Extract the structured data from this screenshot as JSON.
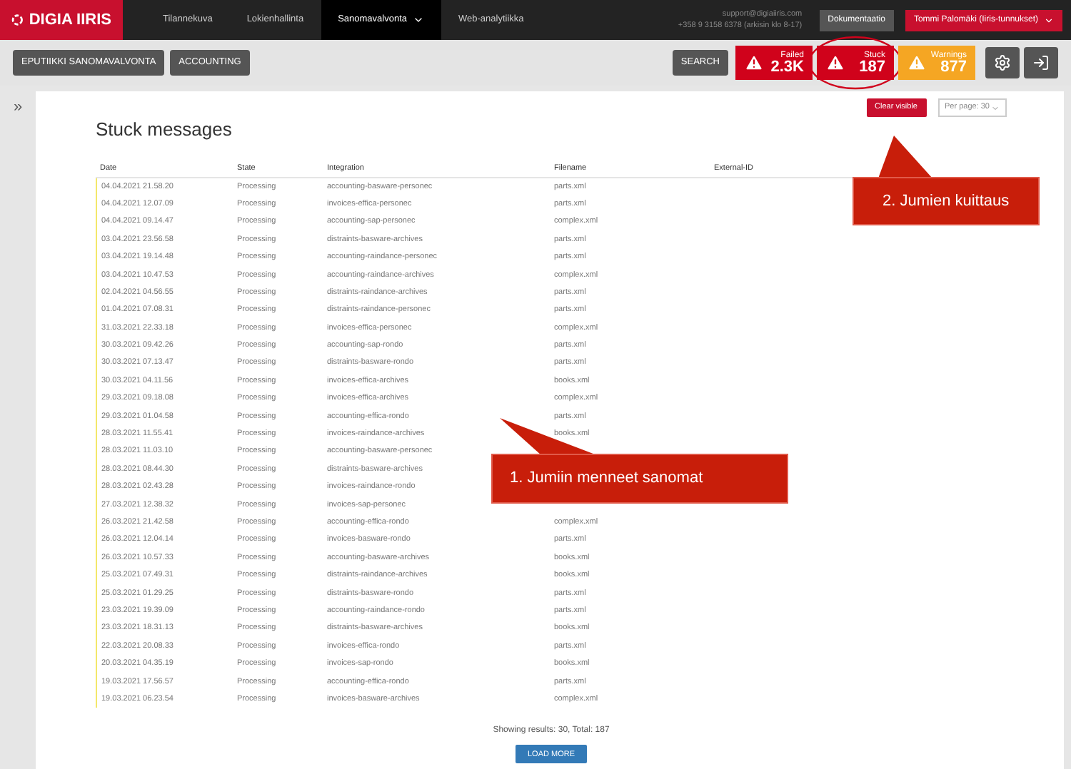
{
  "brand": {
    "name": "DIGIA IIRIS"
  },
  "nav": [
    {
      "label": "Tilannekuva",
      "selected": false
    },
    {
      "label": "Lokienhallinta",
      "selected": false
    },
    {
      "label": "Sanomavalvonta",
      "selected": true,
      "dropdown": true
    },
    {
      "label": "Web-analytiikka",
      "selected": false
    }
  ],
  "support": {
    "email": "support@digiaiiris.com",
    "phone": "+358 9 3158 6378 (arkisin klo 8-17)"
  },
  "docs_button": "Dokumentaatio",
  "user_menu": "Tommi Palomäki (Iiris-tunnukset)",
  "toolbar": {
    "filters": [
      "EPUTIIKKI SANOMAVALVONTA",
      "ACCOUNTING"
    ],
    "search": "SEARCH",
    "counters": [
      {
        "label": "Failed",
        "value": "2.3K",
        "color": "#d0021b",
        "circled": false
      },
      {
        "label": "Stuck",
        "value": "187",
        "color": "#d0021b",
        "circled": true
      },
      {
        "label": "Warnings",
        "value": "877",
        "color": "#f5a623",
        "circled": false
      }
    ]
  },
  "sidebar_toggle": "»",
  "page": {
    "title": "Stuck messages",
    "clear_button": "Clear visible",
    "per_page": "Per page: 30"
  },
  "table": {
    "columns": [
      "Date",
      "State",
      "Integration",
      "Filename",
      "External-ID"
    ],
    "rows": [
      {
        "date": "04.04.2021 21.58.20",
        "state": "Processing",
        "integration": "accounting-basware-personec",
        "filename": "parts.xml"
      },
      {
        "date": "04.04.2021 12.07.09",
        "state": "Processing",
        "integration": "invoices-effica-personec",
        "filename": "parts.xml"
      },
      {
        "date": "04.04.2021 09.14.47",
        "state": "Processing",
        "integration": "accounting-sap-personec",
        "filename": "complex.xml"
      },
      {
        "date": "03.04.2021 23.56.58",
        "state": "Processing",
        "integration": "distraints-basware-archives",
        "filename": "parts.xml"
      },
      {
        "date": "03.04.2021 19.14.48",
        "state": "Processing",
        "integration": "accounting-raindance-personec",
        "filename": "parts.xml"
      },
      {
        "date": "03.04.2021 10.47.53",
        "state": "Processing",
        "integration": "accounting-raindance-archives",
        "filename": "complex.xml"
      },
      {
        "date": "02.04.2021 04.56.55",
        "state": "Processing",
        "integration": "distraints-raindance-archives",
        "filename": "parts.xml"
      },
      {
        "date": "01.04.2021 07.08.31",
        "state": "Processing",
        "integration": "distraints-raindance-personec",
        "filename": "parts.xml"
      },
      {
        "date": "31.03.2021 22.33.18",
        "state": "Processing",
        "integration": "invoices-effica-personec",
        "filename": "complex.xml"
      },
      {
        "date": "30.03.2021 09.42.26",
        "state": "Processing",
        "integration": "accounting-sap-rondo",
        "filename": "parts.xml"
      },
      {
        "date": "30.03.2021 07.13.47",
        "state": "Processing",
        "integration": "distraints-basware-rondo",
        "filename": "parts.xml"
      },
      {
        "date": "30.03.2021 04.11.56",
        "state": "Processing",
        "integration": "invoices-effica-archives",
        "filename": "books.xml"
      },
      {
        "date": "29.03.2021 09.18.08",
        "state": "Processing",
        "integration": "invoices-effica-archives",
        "filename": "complex.xml"
      },
      {
        "date": "29.03.2021 01.04.58",
        "state": "Processing",
        "integration": "accounting-effica-rondo",
        "filename": "parts.xml"
      },
      {
        "date": "28.03.2021 11.55.41",
        "state": "Processing",
        "integration": "invoices-raindance-archives",
        "filename": "books.xml"
      },
      {
        "date": "28.03.2021 11.03.10",
        "state": "Processing",
        "integration": "accounting-basware-personec"
      },
      {
        "date": "28.03.2021 08.44.30",
        "state": "Processing",
        "integration": "distraints-basware-archives"
      },
      {
        "date": "28.03.2021 02.43.28",
        "state": "Processing",
        "integration": "invoices-raindance-rondo"
      },
      {
        "date": "27.03.2021 12.38.32",
        "state": "Processing",
        "integration": "invoices-sap-personec"
      },
      {
        "date": "26.03.2021 21.42.58",
        "state": "Processing",
        "integration": "accounting-effica-rondo",
        "filename": "complex.xml"
      },
      {
        "date": "26.03.2021 12.04.14",
        "state": "Processing",
        "integration": "invoices-basware-rondo",
        "filename": "parts.xml"
      },
      {
        "date": "26.03.2021 10.57.33",
        "state": "Processing",
        "integration": "accounting-basware-archives",
        "filename": "books.xml"
      },
      {
        "date": "25.03.2021 07.49.31",
        "state": "Processing",
        "integration": "distraints-raindance-archives",
        "filename": "books.xml"
      },
      {
        "date": "25.03.2021 01.29.25",
        "state": "Processing",
        "integration": "distraints-basware-rondo",
        "filename": "parts.xml"
      },
      {
        "date": "23.03.2021 19.39.09",
        "state": "Processing",
        "integration": "accounting-raindance-rondo",
        "filename": "parts.xml"
      },
      {
        "date": "23.03.2021 18.31.13",
        "state": "Processing",
        "integration": "distraints-basware-archives",
        "filename": "books.xml"
      },
      {
        "date": "22.03.2021 20.08.33",
        "state": "Processing",
        "integration": "invoices-effica-rondo",
        "filename": "parts.xml"
      },
      {
        "date": "20.03.2021 04.35.19",
        "state": "Processing",
        "integration": "invoices-sap-rondo",
        "filename": "books.xml"
      },
      {
        "date": "19.03.2021 17.56.57",
        "state": "Processing",
        "integration": "accounting-effica-rondo",
        "filename": "parts.xml"
      },
      {
        "date": "19.03.2021 06.23.54",
        "state": "Processing",
        "integration": "invoices-basware-archives",
        "filename": "complex.xml"
      }
    ]
  },
  "summary": "Showing results: 30, Total: 187",
  "load_more": "LOAD MORE",
  "callouts": [
    "1. Jumiin menneet sanomat",
    "2. Jumien kuittaus"
  ]
}
